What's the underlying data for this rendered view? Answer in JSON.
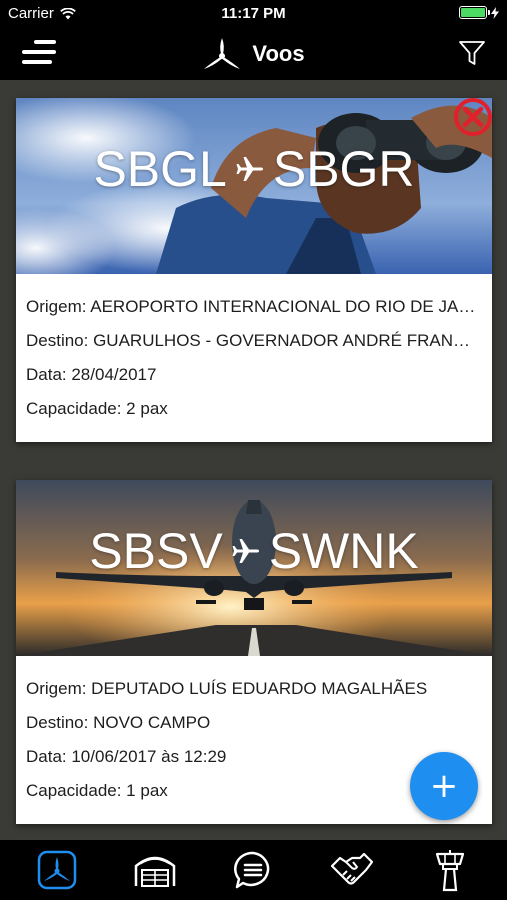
{
  "status_bar": {
    "carrier": "Carrier",
    "time": "11:17 PM",
    "battery_color": "#4cd964"
  },
  "nav": {
    "title": "Voos",
    "menu_icon": "hamburger-menu-icon",
    "logo_icon": "propeller-logo-icon",
    "filter_icon": "funnel-filter-icon"
  },
  "flights": [
    {
      "origin_code": "SBGL",
      "destination_code": "SBGR",
      "origem": "Origem: AEROPORTO INTERNACIONAL DO RIO DE JANEIRO",
      "destino": "Destino: GUARULHOS - GOVERNADOR ANDRÉ FRANCO MONTORO",
      "data": "Data: 28/04/2017",
      "capacidade": "Capacidade: 2 pax",
      "image": "binoculars-sky-photo",
      "has_delete": true
    },
    {
      "origin_code": "SBSV",
      "destination_code": "SWNK",
      "origem": "Origem: DEPUTADO LUÍS EDUARDO MAGALHÃES",
      "destino": "Destino: NOVO CAMPO",
      "data": "Data: 10/06/2017 às 12:29",
      "capacidade": "Capacidade: 1 pax",
      "image": "airplane-runway-sunset-photo",
      "has_delete": false
    }
  ],
  "fab": {
    "label": "+",
    "accent": "#1e8ef0"
  },
  "tabs": [
    {
      "icon": "flights-propeller-icon",
      "active": true
    },
    {
      "icon": "hangar-icon",
      "active": false
    },
    {
      "icon": "chat-list-icon",
      "active": false
    },
    {
      "icon": "handshake-icon",
      "active": false
    },
    {
      "icon": "control-tower-icon",
      "active": false
    }
  ],
  "colors": {
    "active_tab": "#1e8ef0",
    "inactive_tab": "#ffffff",
    "close": "#e0202a"
  }
}
